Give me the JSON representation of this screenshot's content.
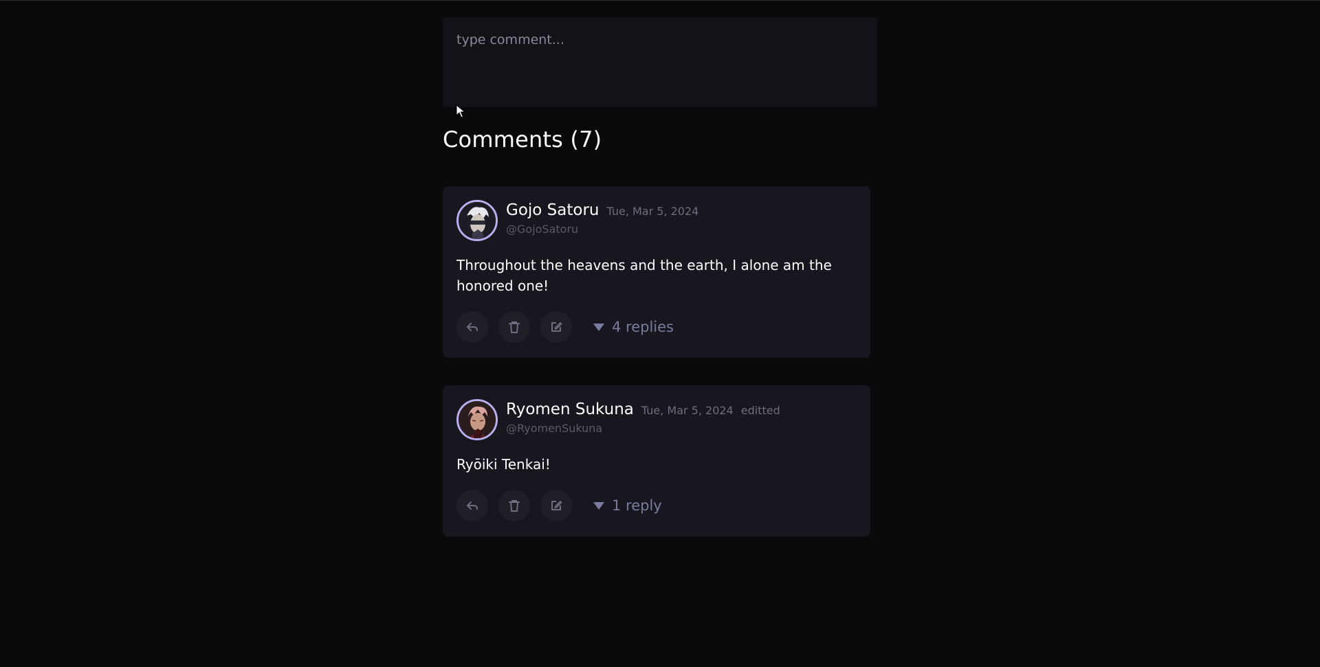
{
  "composer": {
    "placeholder": "type comment..."
  },
  "comments_section": {
    "title": "Comments (7)"
  },
  "comments": [
    {
      "name": "Gojo Satoru",
      "date": "Tue, Mar 5, 2024",
      "edited": "",
      "handle": "@GojoSatoru",
      "text": "Throughout the heavens and the earth, I alone am the honored one!",
      "replies_label": "4 replies"
    },
    {
      "name": "Ryomen Sukuna",
      "date": "Tue, Mar 5, 2024",
      "edited": "editted",
      "handle": "@RyomenSukuna",
      "text": "Ryōiki Tenkai!",
      "replies_label": "1 reply"
    }
  ],
  "icons": {
    "reply": "reply-arrow-icon",
    "delete": "trash-icon",
    "edit": "edit-icon",
    "expand": "triangle-down-icon"
  },
  "colors": {
    "background": "#0a0a0d",
    "card": "#17171f",
    "avatar_ring": "#b9b0f0",
    "muted_accent": "#7b7ba0"
  }
}
